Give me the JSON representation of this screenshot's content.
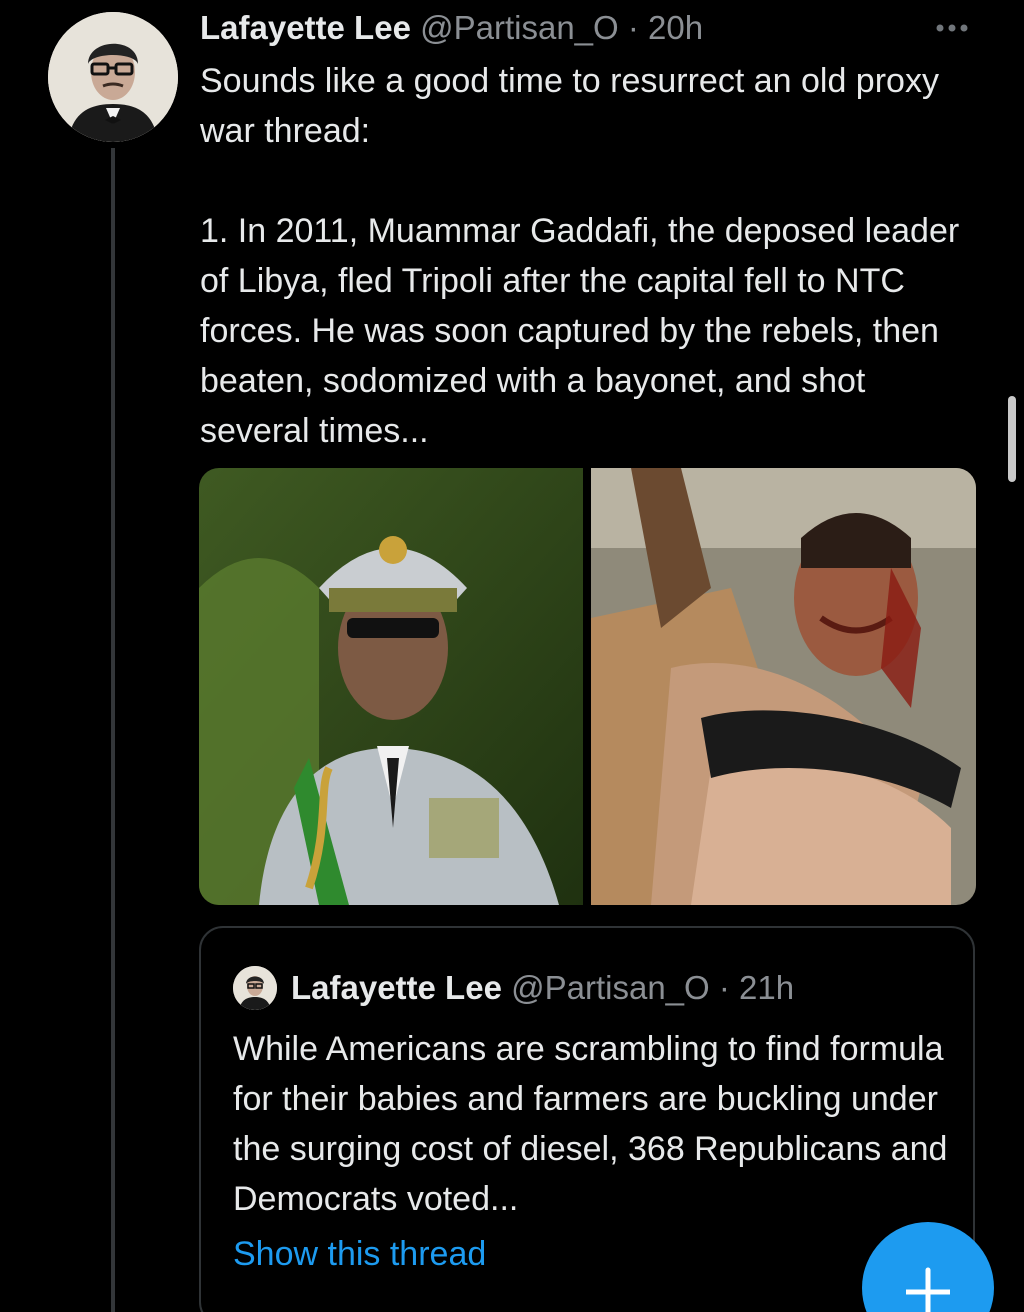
{
  "tweet": {
    "author_name": "Lafayette Lee",
    "author_handle": "@Partisan_O",
    "separator": " · ",
    "time": "20h",
    "text": "Sounds like a good time to resurrect an old proxy war thread:\n\n1. In 2011, Muammar Gaddafi, the deposed leader of Libya, fled Tripoli after the capital fell to NTC forces. He was soon captured by the rebels, then beaten, sodomized with a bayonet, and shot several times...",
    "more_icon": "more-horizontal-icon"
  },
  "quoted_tweet": {
    "author_name": "Lafayette Lee",
    "author_handle": "@Partisan_O",
    "separator": " · ",
    "time": "21h",
    "text": "While Americans are scrambling to find formula for their babies and farmers are buckling under the surging cost of diesel, 368 Republicans and Democrats voted...",
    "show_thread_label": "Show this thread"
  },
  "fab": {
    "icon": "plus-icon",
    "color": "#1d9bf0"
  },
  "colors": {
    "background": "#000000",
    "text": "#e7e9ea",
    "muted": "#8b8f94",
    "accent": "#1d9bf0",
    "border": "#2f3336"
  }
}
